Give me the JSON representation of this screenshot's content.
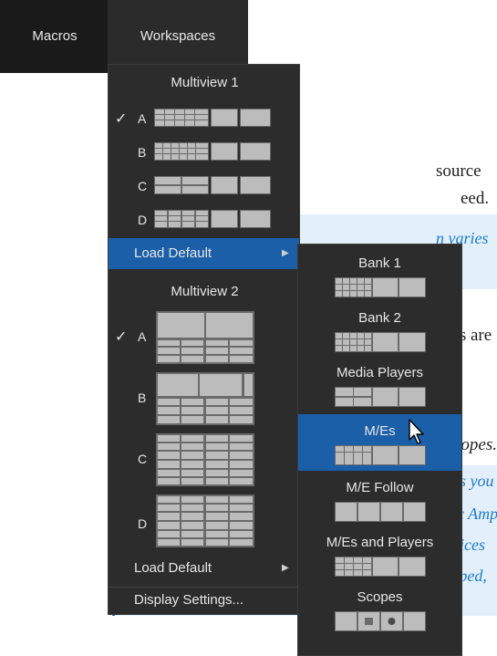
{
  "document": {
    "line1": "source",
    "line2": "eed.",
    "note1": "n varies",
    "line3": "ors are",
    "line4": "copes.",
    "note2": [
      "ets you",
      "oc Amp",
      "devices",
      "ropped,"
    ]
  },
  "menubar": {
    "macros": "Macros",
    "workspaces": "Workspaces"
  },
  "workspaces_menu": {
    "multiview1": {
      "title": "Multiview 1",
      "items": [
        {
          "letter": "A",
          "checked": true,
          "icon": "layout-a-icon"
        },
        {
          "letter": "B",
          "checked": false,
          "icon": "layout-b-icon"
        },
        {
          "letter": "C",
          "checked": false,
          "icon": "layout-c-icon"
        },
        {
          "letter": "D",
          "checked": false,
          "icon": "layout-d-icon"
        }
      ],
      "load_default": "Load Default"
    },
    "multiview2": {
      "title": "Multiview 2",
      "items": [
        {
          "letter": "A",
          "checked": true,
          "icon": "layout-a-icon"
        },
        {
          "letter": "B",
          "checked": false,
          "icon": "layout-b-icon"
        },
        {
          "letter": "C",
          "checked": false,
          "icon": "layout-c-icon"
        },
        {
          "letter": "D",
          "checked": false,
          "icon": "layout-d-icon"
        }
      ],
      "load_default": "Load Default"
    },
    "display_settings": "Display Settings..."
  },
  "load_default_submenu": {
    "items": [
      {
        "label": "Bank 1",
        "active": false
      },
      {
        "label": "Bank 2",
        "active": false
      },
      {
        "label": "Media Players",
        "active": false
      },
      {
        "label": "M/Es",
        "active": true
      },
      {
        "label": "M/E Follow",
        "active": false
      },
      {
        "label": "M/Es and Players",
        "active": false
      },
      {
        "label": "Scopes",
        "active": false
      }
    ]
  },
  "colors": {
    "menu_bg": "#2c2c2c",
    "menubar_bg": "#1a1a1a",
    "highlight": "#1a5fa8",
    "note_text": "#1b7bd0"
  }
}
